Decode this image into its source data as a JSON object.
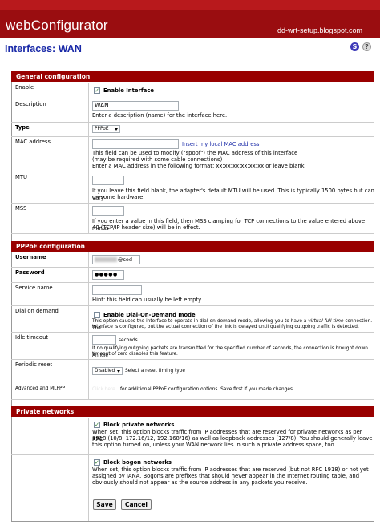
{
  "app": {
    "title": "webConfigurator",
    "watermark": "dd-wrt-setup.blogspot.com"
  },
  "page": {
    "title": "Interfaces: WAN"
  },
  "toolbar": {
    "status_icon": "s-icon",
    "help_icon": "question-icon"
  },
  "general": {
    "header": "General configuration",
    "enable": {
      "label": "Enable",
      "checkbox": "Enable Interface",
      "checked": true
    },
    "description": {
      "label": "Description",
      "value": "WAN",
      "help": "Enter a description (name) for the interface here."
    },
    "type": {
      "label": "Type",
      "value": "PPPoE"
    },
    "mac": {
      "label": "MAC address",
      "value": "",
      "link": "Insert my local MAC address",
      "help1": "This field can be used to modify (\"spoof\") the MAC address of this interface",
      "help2": "(may be required with some cable connections)",
      "help3": "Enter a MAC address in the following format: xx:xx:xx:xx:xx:xx or leave blank"
    },
    "mtu": {
      "label": "MTU",
      "value": "",
      "help1": "If you leave this field blank, the adapter's default MTU will be used. This is typically 1500 bytes but can vary",
      "help2": "on some hardware."
    },
    "mss": {
      "label": "MSS",
      "value": "",
      "help1": "If you enter a value in this field, then MSS clamping for TCP connections to the value entered above minus",
      "help2": "40 (TCP/IP header size) will be in effect."
    }
  },
  "pppoe": {
    "header": "PPPoE configuration",
    "username": {
      "label": "Username",
      "value": "@sod"
    },
    "password": {
      "label": "Password",
      "value": "●●●●●"
    },
    "service": {
      "label": "Service name",
      "value": "",
      "help": "Hint: this field can usually be left empty"
    },
    "dod": {
      "label": "Dial on demand",
      "checkbox": "Enable Dial-On-Demand mode",
      "checked": false,
      "help1": "This option causes the interface to operate in dial-on-demand mode, allowing you to have a",
      "help1_em": "virtual full time",
      "help1_end": "connection. The",
      "help2": "interface is configured, but the actual connection of the link is delayed until qualifying outgoing traffic is detected."
    },
    "idle": {
      "label": "Idle timeout",
      "value": "",
      "unit": "seconds",
      "help1": "If no qualifying outgoing packets are transmitted for the specified number of seconds, the connection is brought down. An idle",
      "help2": "timeout of zero disables this feature."
    },
    "periodic": {
      "label": "Periodic reset",
      "value": "Disabled",
      "help": "Select a reset timing type"
    },
    "advanced": {
      "label": "Advanced and MLPPP",
      "link": "Click here",
      "help": "for additional PPPoE configuration options. Save first if you made changes."
    }
  },
  "private": {
    "header": "Private networks",
    "block_private": {
      "checkbox": "Block private networks",
      "checked": true,
      "help1": "When set, this option blocks traffic from IP addresses that are reserved for private networks as per RFC",
      "help2": "1918 (10/8, 172.16/12, 192.168/16) as well as loopback addresses (127/8).   You should generally leave",
      "help3": "this option turned on, unless your WAN network lies in such a private address space, too."
    },
    "block_bogon": {
      "checkbox": "Block bogon networks",
      "checked": true,
      "help1": "When set, this option blocks traffic from IP addresses that are reserved (but not RFC 1918) or not yet",
      "help2": "assigned by IANA.   Bogons are prefixes that should never appear in the Internet routing table, and",
      "help3": "obviously should not appear as the source address in any packets you receive."
    }
  },
  "actions": {
    "save": "Save",
    "cancel": "Cancel"
  }
}
